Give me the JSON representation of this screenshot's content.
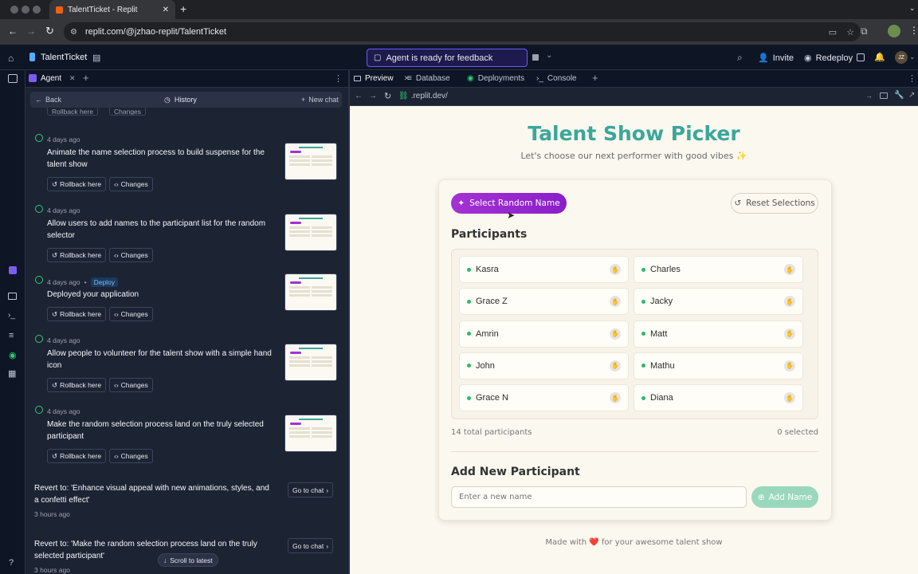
{
  "browser": {
    "tab_title": "TalentTicket - Replit",
    "url": "replit.com/@jzhao-replit/TalentTicket"
  },
  "header": {
    "project_name": "TalentTicket",
    "agent_status": "Agent is ready for feedback",
    "invite_label": "Invite",
    "redeploy_label": "Redeploy",
    "avatar_text": "JZ"
  },
  "agent_panel": {
    "tab_label": "Agent",
    "back_label": "Back",
    "history_label": "History",
    "new_chat_label": "New chat",
    "rollback_label": "Rollback here",
    "changes_label": "Changes",
    "deploy_badge": "Deploy",
    "items": [
      {
        "time": "4 days ago",
        "text": "Animate the name selection process to build suspense for the talent show"
      },
      {
        "time": "4 days ago",
        "text": "Allow users to add names to the participant list for the random selector"
      },
      {
        "time": "4 days ago",
        "text": "Deployed your application"
      },
      {
        "time": "4 days ago",
        "text": "Allow people to volunteer for the talent show with a simple hand icon"
      },
      {
        "time": "4 days ago",
        "text": "Make the random selection process land on the truly selected participant"
      }
    ],
    "reverts": [
      {
        "text": "Revert to: 'Enhance visual appeal with new animations, styles, and a confetti effect'",
        "time": "3 hours ago",
        "button": "Go to chat"
      },
      {
        "text": "Revert to: 'Make the random selection process land on the truly selected participant'",
        "time": "3 hours ago",
        "button": "Go to chat"
      }
    ],
    "scroll_latest": "Scroll to latest"
  },
  "right_tabs": [
    "Preview",
    "Database",
    "Deployments",
    "Console"
  ],
  "preview_url": ".replit.dev/",
  "app": {
    "title": "Talent Show Picker",
    "subtitle": "Let's choose our next performer with good vibes ✨",
    "select_button": "Select Random Name",
    "reset_button": "Reset Selections",
    "participants_heading": "Participants",
    "participants": [
      "Kasra",
      "Charles",
      "Grace Z",
      "Jacky",
      "Amrin",
      "Matt",
      "John",
      "Mathu",
      "Grace N",
      "Diana"
    ],
    "total_text": "14 total participants",
    "selected_text": "0 selected",
    "add_heading": "Add New Participant",
    "input_placeholder": "Enter a new name",
    "add_button": "Add Name",
    "footer": "Made with ❤️ for your awesome talent show"
  },
  "colors": {
    "accent_purple": "#9b2bd6",
    "title_teal": "#3aa79a",
    "add_button_green": "#9ad8bd"
  }
}
